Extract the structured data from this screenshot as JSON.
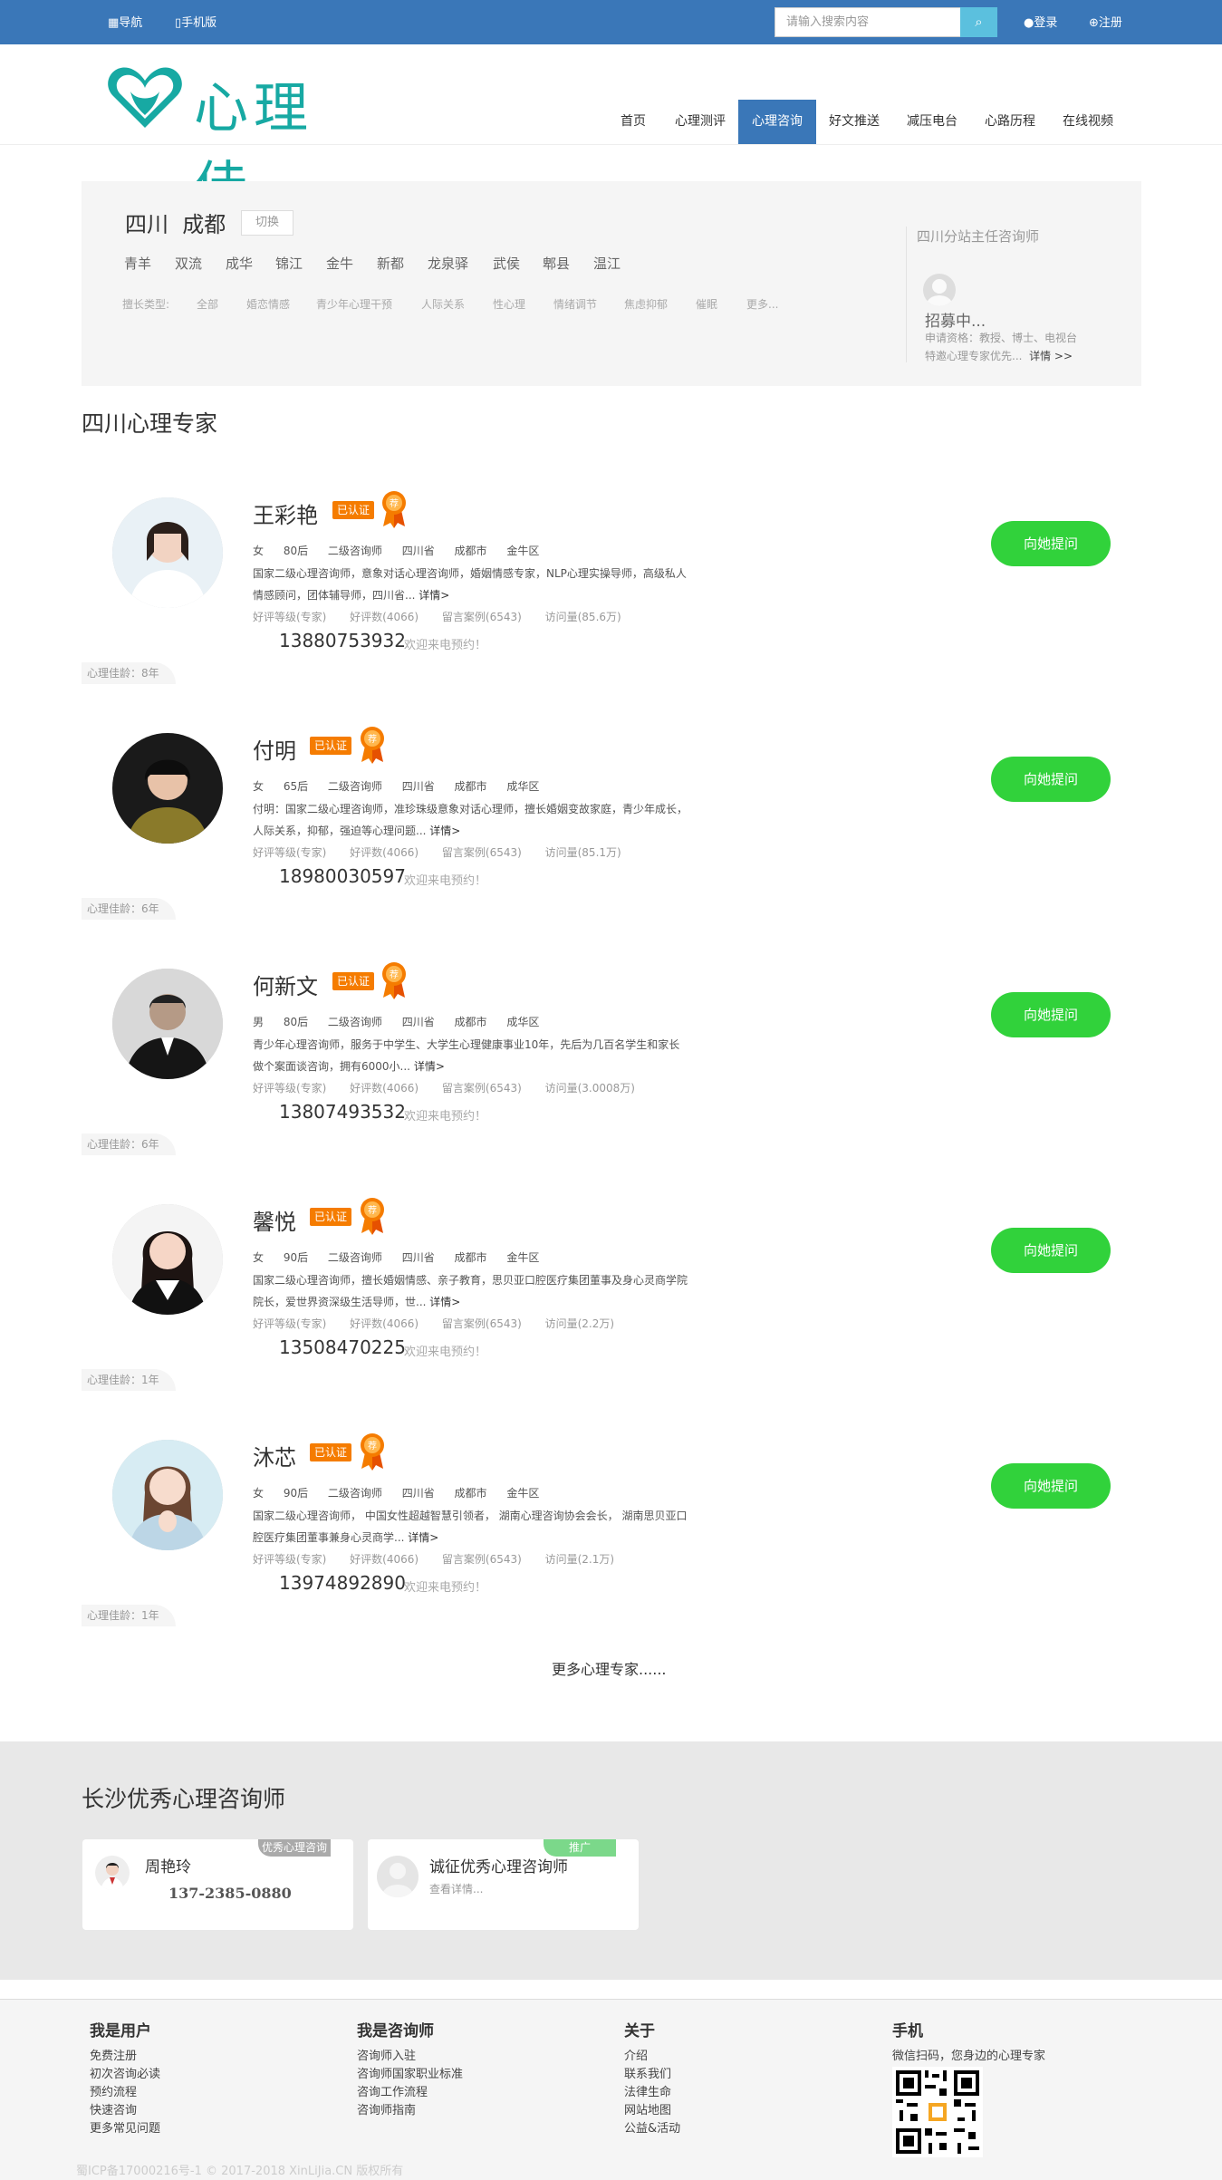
{
  "topbar": {
    "nav": "导航",
    "mobile": "手机版",
    "search_placeholder": "请输入搜索内容",
    "login": "登录",
    "register": "注册"
  },
  "logo": {
    "text": "心理佳"
  },
  "nav": [
    "首页",
    "心理测评",
    "心理咨询",
    "好文推送",
    "减压电台",
    "心路历程",
    "在线视频"
  ],
  "filter": {
    "province": "四川",
    "city": "成都",
    "switch": "切换",
    "districts": [
      "青羊",
      "双流",
      "成华",
      "锦江",
      "金牛",
      "新都",
      "龙泉驿",
      "武侯",
      "郫县",
      "温江"
    ],
    "categories": [
      "擅长类型:",
      "全部",
      "婚恋情感",
      "青少年心理干预",
      "人际关系",
      "性心理",
      "情绪调节",
      "焦虑抑郁",
      "催眠",
      "更多..."
    ],
    "side": {
      "title": "四川分站主任咨询师",
      "recruiting": "招募中...",
      "desc1": "申请资格：教授、博士、电视台",
      "desc2": "特邀心理专家优先...",
      "more": "详情 >>"
    }
  },
  "section_title": "四川心理专家",
  "certified": "已认证",
  "medal": "荐",
  "ask_label": "向她提问",
  "welcome": "欢迎来电预约！",
  "details": "详情>",
  "experts": [
    {
      "name": "王彩艳",
      "line1": "女 80后 二级咨询师 四川省 成都市 金牛区",
      "intro": "国家二级心理咨询师，意象对话心理咨询师，婚姻情感专家，NLP心理实操导师，高级私人情感顾问，团体辅导师，四川省...",
      "stats": "好评等级(专家) 好评数(4066) 留言案例(6543) 访问量(85.6万)",
      "phone": "13880753932",
      "years": "心理佳龄：8年"
    },
    {
      "name": "付明",
      "line1": "女 65后 二级咨询师 四川省 成都市 成华区",
      "intro": "付明：国家二级心理咨询师，准珍珠级意象对话心理师，擅长婚姻变故家庭，青少年成长，人际关系，抑郁，强迫等心理问题...",
      "stats": "好评等级(专家) 好评数(4066) 留言案例(6543) 访问量(85.1万)",
      "phone": "18980030597",
      "years": "心理佳龄：6年"
    },
    {
      "name": "何新文",
      "line1": "男 80后 二级咨询师 四川省 成都市 成华区",
      "intro": "青少年心理咨询师，服务于中学生、大学生心理健康事业10年，先后为几百名学生和家长做个案面谈咨询，拥有6000小...",
      "stats": "好评等级(专家) 好评数(4066) 留言案例(6543) 访问量(3.0008万)",
      "phone": "13807493532",
      "years": "心理佳龄：6年"
    },
    {
      "name": "馨悦",
      "line1": "女 90后 二级咨询师 四川省 成都市 金牛区",
      "intro": "国家二级心理咨询师，擅长婚姻情感、亲子教育，思贝亚口腔医疗集团董事及身心灵商学院院长，爱世界资深级生活导师，世...",
      "stats": "好评等级(专家) 好评数(4066) 留言案例(6543) 访问量(2.2万)",
      "phone": "13508470225",
      "years": "心理佳龄：1年"
    },
    {
      "name": "沐芯",
      "line1": "女 90后 二级咨询师 四川省 成都市 金牛区",
      "intro": "国家二级心理咨询师， 中国女性超越智慧引领者， 湖南心理咨询协会会长， 湖南思贝亚口腔医疗集团董事兼身心灵商学...",
      "stats": "好评等级(专家) 好评数(4066) 留言案例(6543) 访问量(2.1万)",
      "phone": "13974892890",
      "years": "心理佳龄：1年"
    }
  ],
  "more_experts": "更多心理专家......",
  "changsha": {
    "title": "长沙优秀心理咨询师",
    "cards": [
      {
        "tag": "优秀心理咨询师",
        "name": "周艳玲",
        "sub": "137-2385-0880"
      },
      {
        "tag": "推广",
        "name": "诚征优秀心理咨询师",
        "sub": "查看详情..."
      }
    ]
  },
  "footer": {
    "cols": [
      {
        "title": "我是用户",
        "items": [
          "免费注册",
          "初次咨询必读",
          "预约流程",
          "快速咨询",
          "更多常见问题"
        ]
      },
      {
        "title": "我是咨询师",
        "items": [
          "咨询师入驻",
          "咨询师国家职业标准",
          "咨询工作流程",
          "咨询师指南"
        ]
      },
      {
        "title": "关于",
        "items": [
          "介绍",
          "联系我们",
          "法律生命",
          "网站地图",
          "公益&活动"
        ]
      },
      {
        "title": "手机",
        "items": [
          "微信扫码，您身边的心理专家"
        ]
      }
    ],
    "copyright": "蜀ICP备17000216号-1 © 2017-2018 XinLiJia.CN 版权所有"
  },
  "colors": {
    "primary": "#3a77b8",
    "accent": "#31d23b",
    "badge": "#f57c00",
    "teal": "#17a9a3"
  }
}
